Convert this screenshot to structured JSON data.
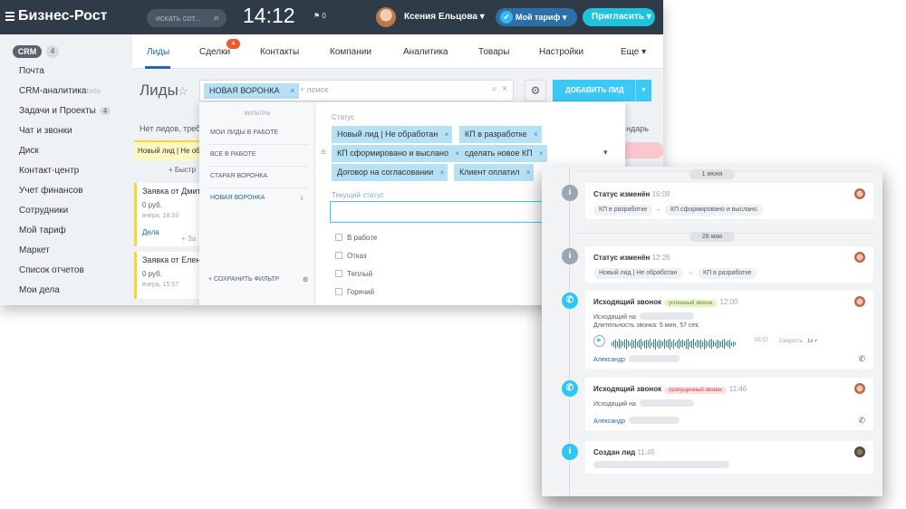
{
  "topbar": {
    "logo": "Бизнес-Рост",
    "search_placeholder": "искать сот...",
    "clock": "14:12",
    "flag": "⚑ 0",
    "user_name": "Ксения Ельцова",
    "tariff_label": "Мой тариф",
    "invite_label": "Пригласить"
  },
  "sidebar": {
    "crm_label": "CRM",
    "crm_count": "4",
    "items": [
      {
        "label": "Почта"
      },
      {
        "label": "CRM-аналитика",
        "beta": "beta"
      },
      {
        "label": "Задачи и Проекты",
        "count": "4"
      },
      {
        "label": "Чат и звонки"
      },
      {
        "label": "Диск"
      },
      {
        "label": "Контакт-центр"
      },
      {
        "label": "Учет финансов"
      },
      {
        "label": "Сотрудники"
      },
      {
        "label": "Мой тариф"
      },
      {
        "label": "Маркет"
      },
      {
        "label": "Список отчетов"
      },
      {
        "label": "Мои дела"
      }
    ]
  },
  "tabs": {
    "items": [
      "Лиды",
      "Сделки",
      "Контакты",
      "Компании",
      "Аналитика",
      "Товары",
      "Настройки",
      "Еще"
    ],
    "deals_badge": "4"
  },
  "page": {
    "title": "Лиды",
    "filter_chip": "НОВАЯ ВОРОНКА",
    "search_placeholder": "+ поиск",
    "add_button": "ДОБАВИТЬ ЛИД",
    "subline": "Нет лидов, треб",
    "calendar_tail": "ндарь",
    "stage_name": "Новый лид | Не обр",
    "quick_add": "+ Быстр",
    "quick_add_mid": "+ За",
    "cards": [
      {
        "title": "Заявка от Дмитр",
        "sum": "0 руб.",
        "date": "вчера, 18:33",
        "action": "Дела"
      },
      {
        "title": "Заявка от Елена",
        "sum": "0 руб.",
        "date": "вчера, 15:57",
        "action": ""
      }
    ]
  },
  "filter_popup": {
    "header": "ФИЛЬТРЫ",
    "presets": [
      "МОИ ЛИДЫ В РАБОТЕ",
      "ВСЕ В РАБОТЕ",
      "СТАРАЯ ВОРОНКА",
      "НОВАЯ ВОРОНКА"
    ],
    "save_label": "+ СОХРАНИТЬ ФИЛЬТР",
    "status_label": "Статус",
    "status_tags": [
      "Новый лид | Не обработан",
      "КП в разработке",
      "КП сформировано и выслано",
      "сделать новое КП",
      "Договор на согласовании",
      "Клиент оплатил"
    ],
    "current_status_label": "Текущий статус",
    "options": [
      "В работе",
      "Отказ",
      "Теплый",
      "Горячий"
    ]
  },
  "timeline": {
    "dates": [
      "1 июня",
      "28 мая"
    ],
    "events": [
      {
        "title": "Статус изменён",
        "time": "16:08",
        "from": "КП в разработке",
        "to": "КП сформировано и выслано"
      },
      {
        "title": "Статус изменён",
        "time": "12:26",
        "from": "Новый лид | Не обработан",
        "to": "КП в разработке"
      },
      {
        "title": "Исходящий звонок",
        "badge": "успешный звонок",
        "time": "12:00",
        "line1": "Исходящий на",
        "line2": "Длительность звонка: 5 мин, 57 сек.",
        "duration": "05:57",
        "speed_label": "Скорость",
        "speed_value": "1x",
        "person": "Александр"
      },
      {
        "title": "Исходящий звонок",
        "badge": "пропущенный звонок",
        "time": "11:46",
        "line1": "Исходящий на",
        "person": "Александр"
      },
      {
        "title": "Создан лид",
        "time": "11:45"
      }
    ]
  },
  "colors": {
    "topbar": "#2f3b47",
    "accent": "#3bc8f5",
    "tag_bg": "#b6e0f3",
    "link": "#2066b0",
    "invite": "#1ec4dc"
  }
}
